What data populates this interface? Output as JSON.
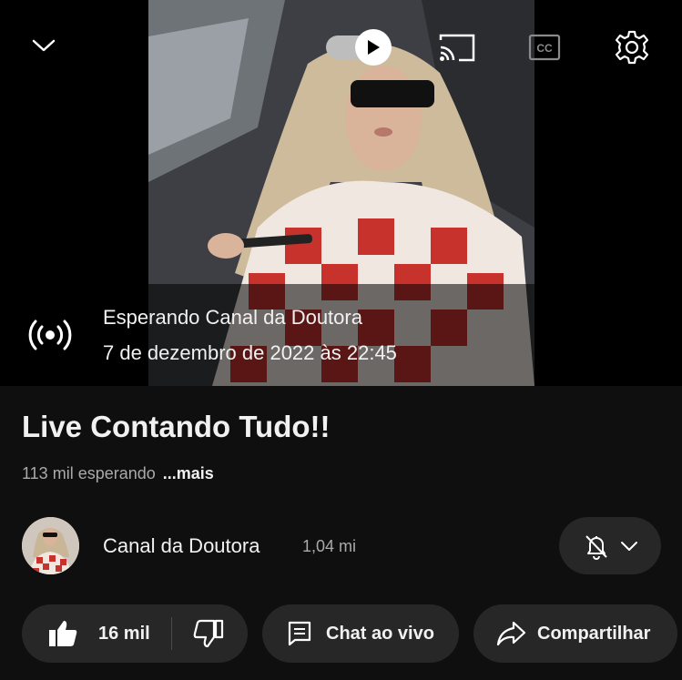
{
  "player": {
    "status_title": "Esperando Canal da Doutora",
    "status_datetime": "7 de dezembro de 2022 às 22:45",
    "autoplay_on": true,
    "icons": [
      "chevron-down-icon",
      "autoplay-toggle",
      "cast-icon",
      "captions-icon",
      "gear-icon",
      "live-broadcast-icon"
    ]
  },
  "video": {
    "title": "Live Contando Tudo!!",
    "waiting_count": "113 mil esperando",
    "more_label": "...mais"
  },
  "channel": {
    "name": "Canal da Doutora",
    "subscribers": "1,04 mi"
  },
  "actions": {
    "like_count": "16 mil",
    "chat_label": "Chat ao vivo",
    "share_label": "Compartilhar"
  },
  "colors": {
    "background": "#0f0f0f",
    "pill": "#272727",
    "text": "#f1f1f1",
    "muted": "#aaaaaa"
  }
}
